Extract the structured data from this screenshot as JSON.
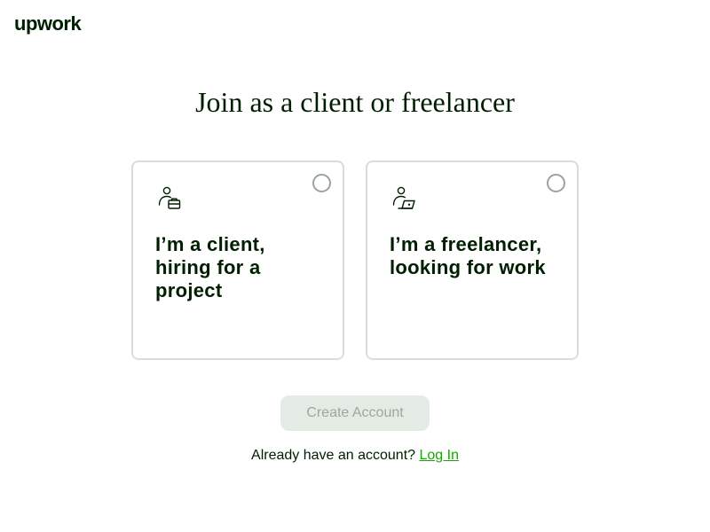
{
  "brand": {
    "logo_text": "upwork"
  },
  "page": {
    "title": "Join as a client or freelancer"
  },
  "options": [
    {
      "label": "I’m a client, hiring for a project",
      "icon": "client-briefcase-icon",
      "selected": false
    },
    {
      "label": "I’m a freelancer, looking for work",
      "icon": "freelancer-laptop-icon",
      "selected": false
    }
  ],
  "actions": {
    "create_account_label": "Create Account",
    "create_account_disabled": true
  },
  "login": {
    "prompt": "Already have an account?",
    "link_label": "Log In"
  },
  "colors": {
    "brand_green": "#14a800",
    "text_dark": "#001e00",
    "card_border": "#d5e0d5",
    "disabled_bg": "#e4ebe4",
    "disabled_text": "#9aaa97"
  }
}
